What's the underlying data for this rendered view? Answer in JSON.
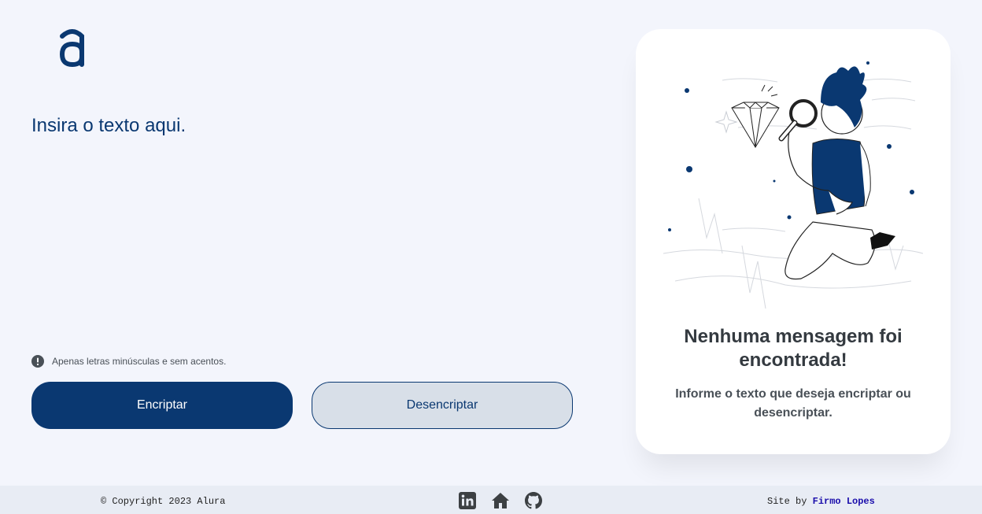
{
  "logo": {
    "name": "alura-logo-icon"
  },
  "editor": {
    "placeholder": "Insira o texto aqui."
  },
  "hint": {
    "icon": "exclamation-circle-icon",
    "text": "Apenas letras minúsculas e sem acentos."
  },
  "buttons": {
    "encrypt_label": "Encriptar",
    "decrypt_label": "Desencriptar"
  },
  "output": {
    "illustration": "person-with-magnifying-glass-looking-at-diamond",
    "title": "Nenhuma mensagem foi encontrada!",
    "text": "Informe o texto que deseja encriptar ou desencriptar."
  },
  "footer": {
    "copyright": "© Copyright 2023 Alura",
    "social_icons": [
      "linkedin-icon",
      "home-icon",
      "github-icon"
    ],
    "credit_prefix": "Site by",
    "credit_name": "Firmo Lopes"
  },
  "colors": {
    "primary": "#0a3871",
    "background": "#f3f5fc",
    "secondary_button": "#d8dfe8",
    "footer_bg": "#e8ecf4"
  }
}
